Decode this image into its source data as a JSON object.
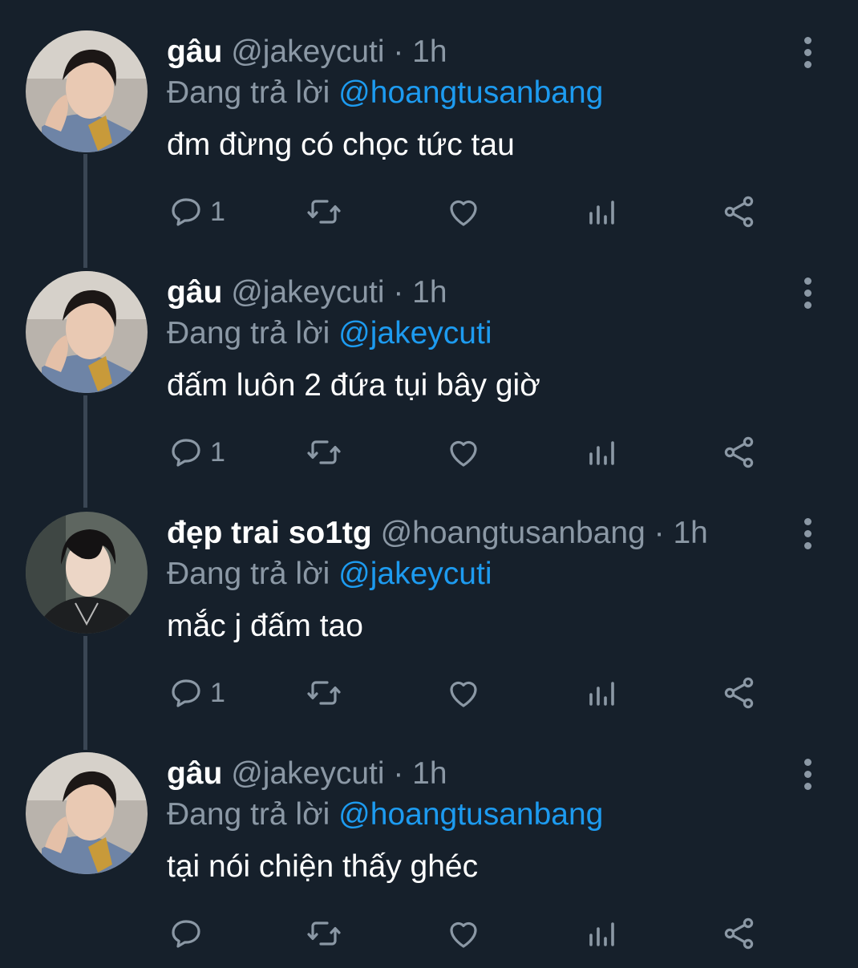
{
  "colors": {
    "background": "#16202b",
    "text": "#ffffff",
    "muted": "#8b98a5",
    "accent": "#1d9bf0",
    "thread_line": "#3a4654"
  },
  "tweets": [
    {
      "name": "gâu",
      "handle": "@jakeycuti",
      "time": "· 1h",
      "reply_prefix": "Đang trả lời",
      "reply_to": "@hoangtusanbang",
      "text": "đm đừng có chọc tức tau",
      "reply_count": "1",
      "avatar": "avatar-photo-jakeycuti"
    },
    {
      "name": "gâu",
      "handle": "@jakeycuti",
      "time": "· 1h",
      "reply_prefix": "Đang trả lời",
      "reply_to": "@jakeycuti",
      "text": "đấm luôn 2 đứa tụi bây giờ",
      "reply_count": "1",
      "avatar": "avatar-photo-jakeycuti"
    },
    {
      "name": "đẹp trai so1tg",
      "handle": "@hoangtusanbang",
      "time": "· 1h",
      "reply_prefix": "Đang trả lời",
      "reply_to": "@jakeycuti",
      "text": "mắc j đấm tao",
      "reply_count": "1",
      "avatar": "avatar-photo-hoangtusanbang"
    },
    {
      "name": "gâu",
      "handle": "@jakeycuti",
      "time": "· 1h",
      "reply_prefix": "Đang trả lời",
      "reply_to": "@hoangtusanbang",
      "text": "tại nói chiện thấy ghéc",
      "reply_count": "",
      "avatar": "avatar-photo-jakeycuti"
    }
  ],
  "icons": [
    "reply-icon",
    "retweet-icon",
    "like-icon",
    "analytics-icon",
    "share-icon",
    "more-icon"
  ]
}
